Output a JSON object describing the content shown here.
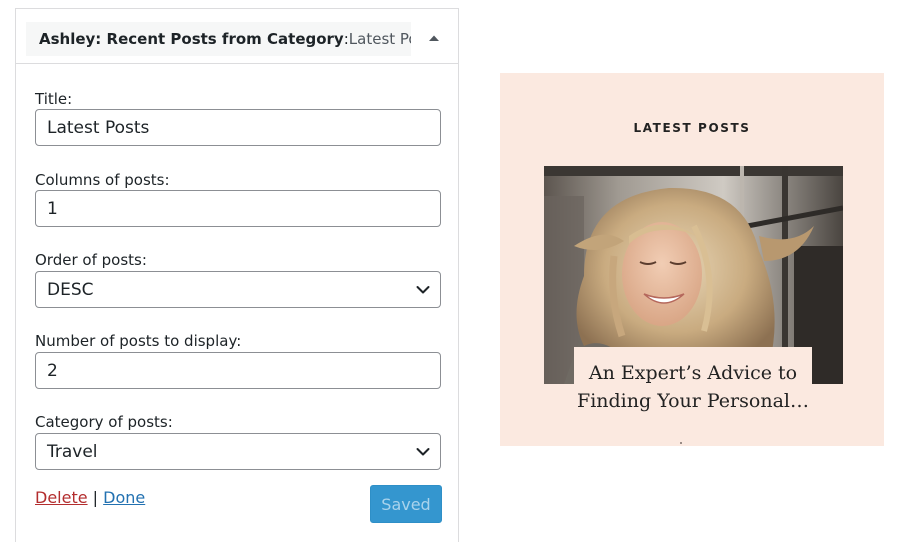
{
  "widget": {
    "title_main": "Ashley: Recent Posts from Category",
    "title_sep": ": ",
    "title_sub": "Latest Po...",
    "toggle_icon": "triangle-up-icon",
    "fields": {
      "title": {
        "label": "Title:",
        "value": "Latest Posts"
      },
      "columns": {
        "label": "Columns of posts:",
        "value": "1"
      },
      "order": {
        "label": "Order of posts:",
        "value": "DESC"
      },
      "number": {
        "label": "Number of posts to display:",
        "value": "2"
      },
      "category": {
        "label": "Category of posts:",
        "value": "Travel"
      }
    },
    "delete_label": "Delete",
    "link_separator": " | ",
    "done_label": "Done",
    "saved_label": "Saved"
  },
  "preview": {
    "heading": "LATEST POSTS",
    "post_title_line1": "An Expert’s Advice to",
    "post_title_line2": "Finding Your Personal…",
    "background_color": "#fbe9e0"
  },
  "colors": {
    "accent": "#2271b1",
    "delete": "#b32d2e",
    "saved_button": "#3496cf"
  }
}
